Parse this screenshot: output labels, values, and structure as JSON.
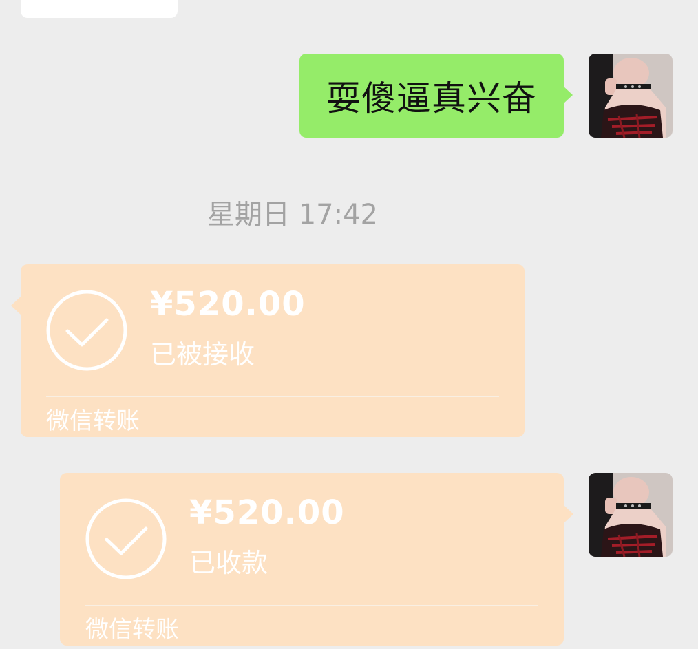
{
  "messages": {
    "text_message": "耍傻逼真兴奋",
    "timestamp": "星期日 17:42",
    "transfer_received": {
      "amount": "¥520.00",
      "status": "已被接收",
      "footer": "微信转账"
    },
    "transfer_collected": {
      "amount": "¥520.00",
      "status": "已收款",
      "footer": "微信转账"
    }
  },
  "colors": {
    "background": "#ededed",
    "sent_bubble": "#95ec69",
    "transfer_bubble": "#fde1c3",
    "timestamp_text": "#a3a3a3"
  },
  "icons": {
    "transfer_status": "check-circle-icon",
    "avatar": "user-avatar-photo"
  }
}
